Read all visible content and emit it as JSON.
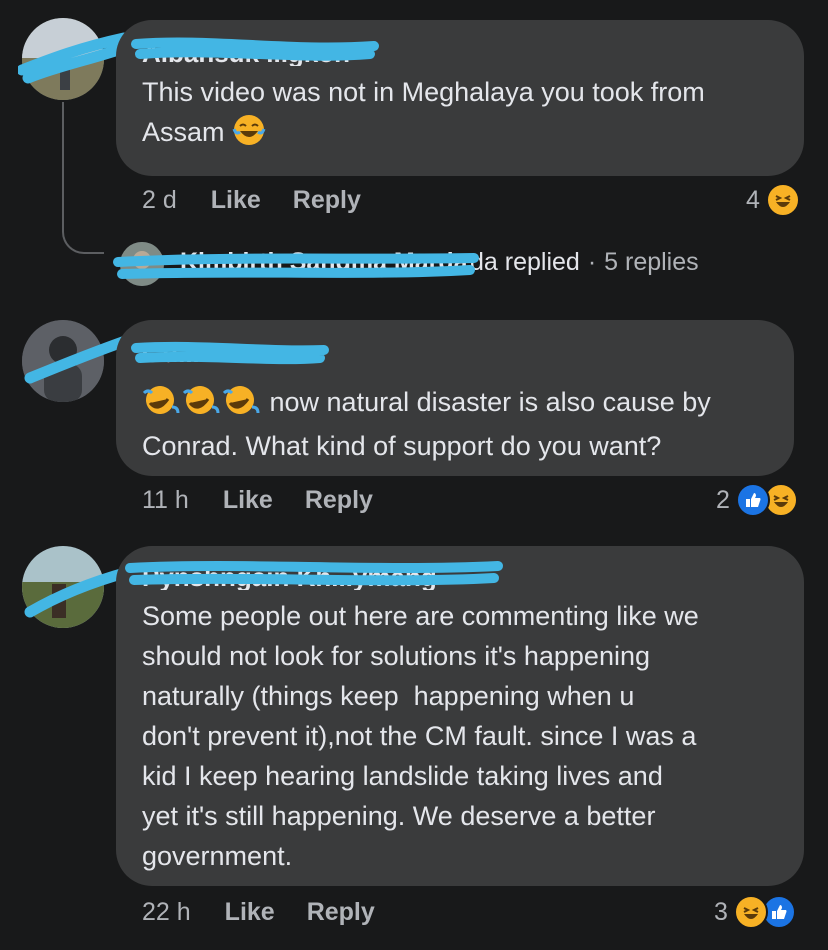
{
  "comments": [
    {
      "author": "Aibansuk ...gkoh",
      "text_lines": [
        "This video was not in Meghalaya you took from",
        "Assam"
      ],
      "time": "2 d",
      "like_label": "Like",
      "reply_label": "Reply",
      "reaction_count": "4",
      "reactions": [
        "haha-icon"
      ]
    },
    {
      "author": "Gu... ...",
      "emoji_prefix": [
        "rofl-icon",
        "rofl-icon",
        "rofl-icon"
      ],
      "text_lines": [
        " now natural disaster is also cause by",
        "Conrad. What kind of support do you want?"
      ],
      "time": "11 h",
      "like_label": "Like",
      "reply_label": "Reply",
      "reaction_count": "2",
      "reactions": [
        "like-icon",
        "haha-icon"
      ]
    },
    {
      "author": "Pynshngain Kh...ymang",
      "text_lines": [
        "Some people out here are commenting like we",
        "should not look for solutions it's happening",
        "naturally (things keep  happening when u",
        "don't prevent it),not the CM fault. since I was a",
        "kid I keep hearing landslide taking lives and",
        "yet it's still happening. We deserve a better",
        "government."
      ],
      "time": "22 h",
      "like_label": "Like",
      "reply_label": "Reply",
      "reaction_count": "3",
      "reactions": [
        "haha-icon",
        "like-icon"
      ]
    }
  ],
  "reply_summary": {
    "author": "Kimbirth Sangma Marda",
    "replied_text": "da replied",
    "separator": "·",
    "replies_count": "5 replies"
  },
  "colors": {
    "background": "#18191a",
    "bubble": "#3a3b3c",
    "text": "#e4e6eb",
    "muted": "#b0b3b8",
    "scribble": "#43b6e4",
    "like": "#1b74e4",
    "haha": "#f7b125"
  }
}
